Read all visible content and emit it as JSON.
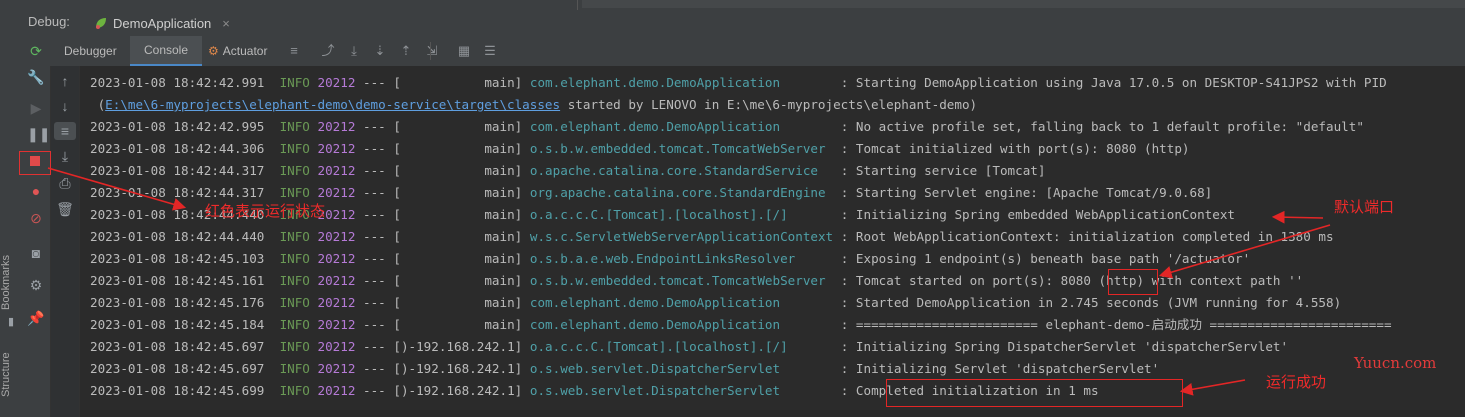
{
  "window": {
    "debug_label": "Debug:",
    "run_tab": "DemoApplication"
  },
  "tabs": {
    "debugger": "Debugger",
    "console": "Console",
    "actuator": "Actuator"
  },
  "sidebar": {
    "bookmarks": "Bookmarks",
    "structure": "Structure"
  },
  "console_lines": [
    {
      "ts": "2023-01-08 18:42:42.991",
      "level": "INFO",
      "pid": "20212",
      "sep": "--- [",
      "thread": "           main]",
      "logger": "com.elephant.demo.DemoApplication       ",
      "msg": " : Starting DemoApplication using Java 17.0.5 on DESKTOP-S41JPS2 with PID"
    },
    {
      "cont_pre": " (",
      "cont_link": "E:\\me\\6-myprojects\\elephant-demo\\demo-service\\target\\classes",
      "cont_post": " started by LENOVO in E:\\me\\6-myprojects\\elephant-demo)"
    },
    {
      "ts": "2023-01-08 18:42:42.995",
      "level": "INFO",
      "pid": "20212",
      "sep": "--- [",
      "thread": "           main]",
      "logger": "com.elephant.demo.DemoApplication       ",
      "msg": " : No active profile set, falling back to 1 default profile: \"default\""
    },
    {
      "ts": "2023-01-08 18:42:44.306",
      "level": "INFO",
      "pid": "20212",
      "sep": "--- [",
      "thread": "           main]",
      "logger": "o.s.b.w.embedded.tomcat.TomcatWebServer ",
      "msg": " : Tomcat initialized with port(s): 8080 (http)"
    },
    {
      "ts": "2023-01-08 18:42:44.317",
      "level": "INFO",
      "pid": "20212",
      "sep": "--- [",
      "thread": "           main]",
      "logger": "o.apache.catalina.core.StandardService  ",
      "msg": " : Starting service [Tomcat]"
    },
    {
      "ts": "2023-01-08 18:42:44.317",
      "level": "INFO",
      "pid": "20212",
      "sep": "--- [",
      "thread": "           main]",
      "logger": "org.apache.catalina.core.StandardEngine ",
      "msg": " : Starting Servlet engine: [Apache Tomcat/9.0.68]"
    },
    {
      "ts": "2023-01-08 18:42:44.440",
      "level": "INFO",
      "pid": "20212",
      "sep": "--- [",
      "thread": "           main]",
      "logger": "o.a.c.c.C.[Tomcat].[localhost].[/]      ",
      "msg": " : Initializing Spring embedded WebApplicationContext"
    },
    {
      "ts": "2023-01-08 18:42:44.440",
      "level": "INFO",
      "pid": "20212",
      "sep": "--- [",
      "thread": "           main]",
      "logger": "w.s.c.ServletWebServerApplicationContext",
      "msg": " : Root WebApplicationContext: initialization completed in 1380 ms"
    },
    {
      "ts": "2023-01-08 18:42:45.103",
      "level": "INFO",
      "pid": "20212",
      "sep": "--- [",
      "thread": "           main]",
      "logger": "o.s.b.a.e.web.EndpointLinksResolver     ",
      "msg": " : Exposing 1 endpoint(s) beneath base path '/actuator'"
    },
    {
      "ts": "2023-01-08 18:42:45.161",
      "level": "INFO",
      "pid": "20212",
      "sep": "--- [",
      "thread": "           main]",
      "logger": "o.s.b.w.embedded.tomcat.TomcatWebServer ",
      "msg": " : Tomcat started on port(s): 8080 (http) with context path ''"
    },
    {
      "ts": "2023-01-08 18:42:45.176",
      "level": "INFO",
      "pid": "20212",
      "sep": "--- [",
      "thread": "           main]",
      "logger": "com.elephant.demo.DemoApplication       ",
      "msg": " : Started DemoApplication in 2.745 seconds (JVM running for 4.558)"
    },
    {
      "ts": "2023-01-08 18:42:45.184",
      "level": "INFO",
      "pid": "20212",
      "sep": "--- [",
      "thread": "           main]",
      "logger": "com.elephant.demo.DemoApplication       ",
      "msg": " : ======================== elephant-demo-启动成功 ========================"
    },
    {
      "ts": "2023-01-08 18:42:45.697",
      "level": "INFO",
      "pid": "20212",
      "sep": "--- [",
      "thread": ")-192.168.242.1]",
      "logger": "o.a.c.c.C.[Tomcat].[localhost].[/]      ",
      "msg": " : Initializing Spring DispatcherServlet 'dispatcherServlet'"
    },
    {
      "ts": "2023-01-08 18:42:45.697",
      "level": "INFO",
      "pid": "20212",
      "sep": "--- [",
      "thread": ")-192.168.242.1]",
      "logger": "o.s.web.servlet.DispatcherServlet       ",
      "msg": " : Initializing Servlet 'dispatcherServlet'"
    },
    {
      "ts": "2023-01-08 18:42:45.699",
      "level": "INFO",
      "pid": "20212",
      "sep": "--- [",
      "thread": ")-192.168.242.1]",
      "logger": "o.s.web.servlet.DispatcherServlet       ",
      "msg": " : Completed initialization in 1 ms"
    }
  ],
  "annotations": {
    "running_state": "红色表示运行状态",
    "default_port": "默认端口",
    "run_success": "运行成功",
    "watermark": "Yuucn.com"
  },
  "colors": {
    "accent": "#4a88c7",
    "annotation": "#e32626",
    "info": "#6a9955",
    "logger": "#4fa0a8",
    "pid": "#b57ad6"
  }
}
